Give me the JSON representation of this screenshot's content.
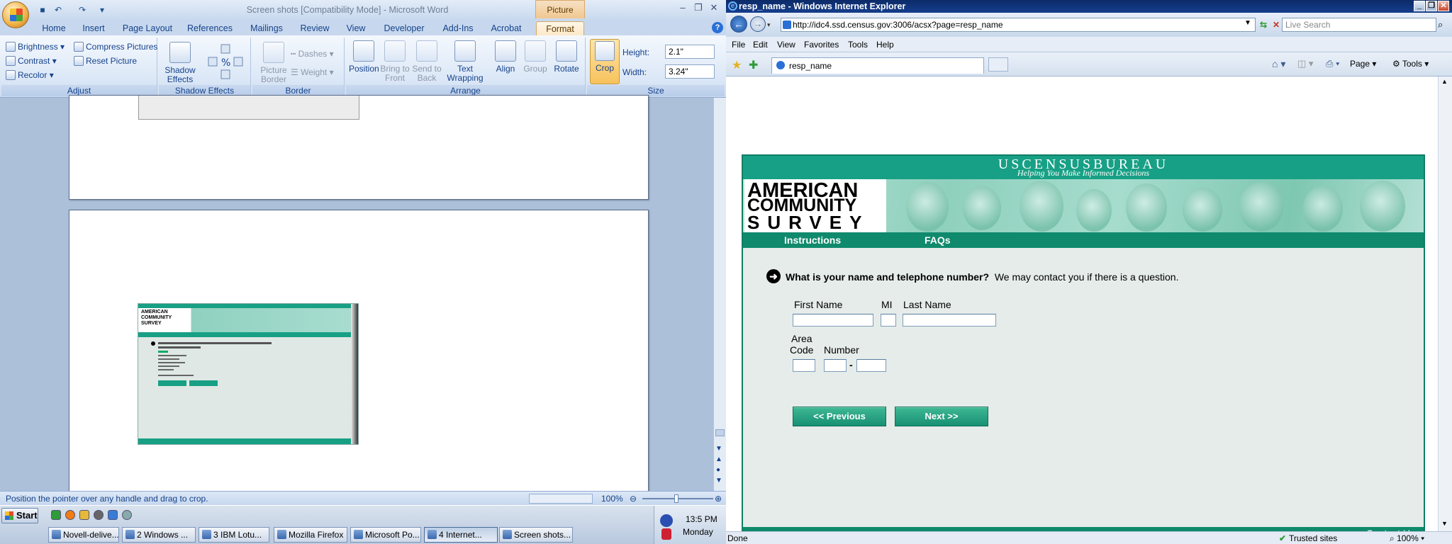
{
  "word": {
    "title": "Screen shots [Compatibility Mode] - Microsoft Word",
    "contextual_tab": "Picture Tools",
    "tabs": [
      "Home",
      "Insert",
      "Page Layout",
      "References",
      "Mailings",
      "Review",
      "View",
      "Developer",
      "Add-Ins",
      "Acrobat",
      "Format"
    ],
    "active_tab": "Format",
    "ribbon": {
      "adjust": {
        "label": "Adjust",
        "brightness": "Brightness",
        "contrast": "Contrast",
        "recolor": "Recolor",
        "compress": "Compress Pictures",
        "reset": "Reset Picture"
      },
      "shadow": {
        "label": "Shadow Effects",
        "button": "Shadow Effects"
      },
      "border": {
        "label": "Border",
        "picture_border": "Picture Border",
        "dashes": "Dashes",
        "weight": "Weight"
      },
      "arrange": {
        "label": "Arrange",
        "position": "Position",
        "bring_front": "Bring to Front",
        "send_back": "Send to Back",
        "text_wrap": "Text Wrapping",
        "align": "Align",
        "group": "Group",
        "rotate": "Rotate"
      },
      "size": {
        "label": "Size",
        "crop": "Crop",
        "height_label": "Height:",
        "height_value": "2.1\"",
        "width_label": "Width:",
        "width_value": "3.24\""
      }
    },
    "status_text": "Position the pointer over any handle and drag to crop.",
    "zoom": "100%"
  },
  "ie": {
    "title": "resp_name - Windows Internet Explorer",
    "url": "http://idc4.ssd.census.gov:3006/acsx?page=resp_name",
    "search_placeholder": "Live Search",
    "menu": [
      "File",
      "Edit",
      "View",
      "Favorites",
      "Tools",
      "Help"
    ],
    "tab_label": "resp_name",
    "cmd_page": "Page",
    "cmd_tools": "Tools",
    "status_done": "Done",
    "status_zone": "Trusted sites",
    "status_zoom": "100%"
  },
  "survey": {
    "bureau": "USCENSUSBUREAU",
    "tagline": "Helping You Make Informed Decisions",
    "logo_lines": [
      "AMERICAN",
      "COMMUNITY",
      "SURVEY"
    ],
    "nav": {
      "instructions": "Instructions",
      "faqs": "FAQs"
    },
    "question_bold": "What is your name and telephone number?",
    "question_rest": "We may contact you if there is a question.",
    "labels": {
      "first": "First Name",
      "mi": "MI",
      "last": "Last Name",
      "area1": "Area",
      "area2": "Code",
      "number": "Number",
      "dash": "-"
    },
    "fields": {
      "first": "",
      "mi": "",
      "last": "",
      "area": "",
      "prefix": "",
      "line": ""
    },
    "prev_button": "<<   Previous",
    "next_button": "Next   >>",
    "contact": "Contact Us"
  },
  "thumb": {
    "logo_lines": [
      "AMERICAN",
      "COMMUNITY",
      "SURVEY"
    ]
  },
  "taskbar": {
    "start": "Start",
    "tasks": [
      "Novell-delive...",
      "2 Windows ...",
      "3 IBM Lotu...",
      "Mozilla Firefox",
      "Microsoft Po...",
      "4 Internet...",
      "Screen shots..."
    ],
    "active_task": 5,
    "clock": "13:5 PM",
    "day": "Monday"
  }
}
